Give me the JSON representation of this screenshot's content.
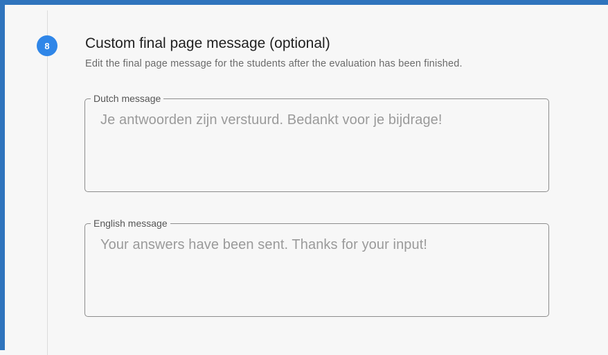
{
  "step": {
    "number": "8",
    "title": "Custom final page message (optional)",
    "subtitle": "Edit the final page message for the students after the evaluation has been finished."
  },
  "fields": {
    "dutch": {
      "label": "Dutch message",
      "value": "Je antwoorden zijn verstuurd. Bedankt voor je bijdrage!"
    },
    "english": {
      "label": "English message",
      "value": "Your answers have been sent. Thanks for your input!"
    }
  },
  "colors": {
    "accent_border": "#2f74bd",
    "badge": "#2f86e8"
  }
}
